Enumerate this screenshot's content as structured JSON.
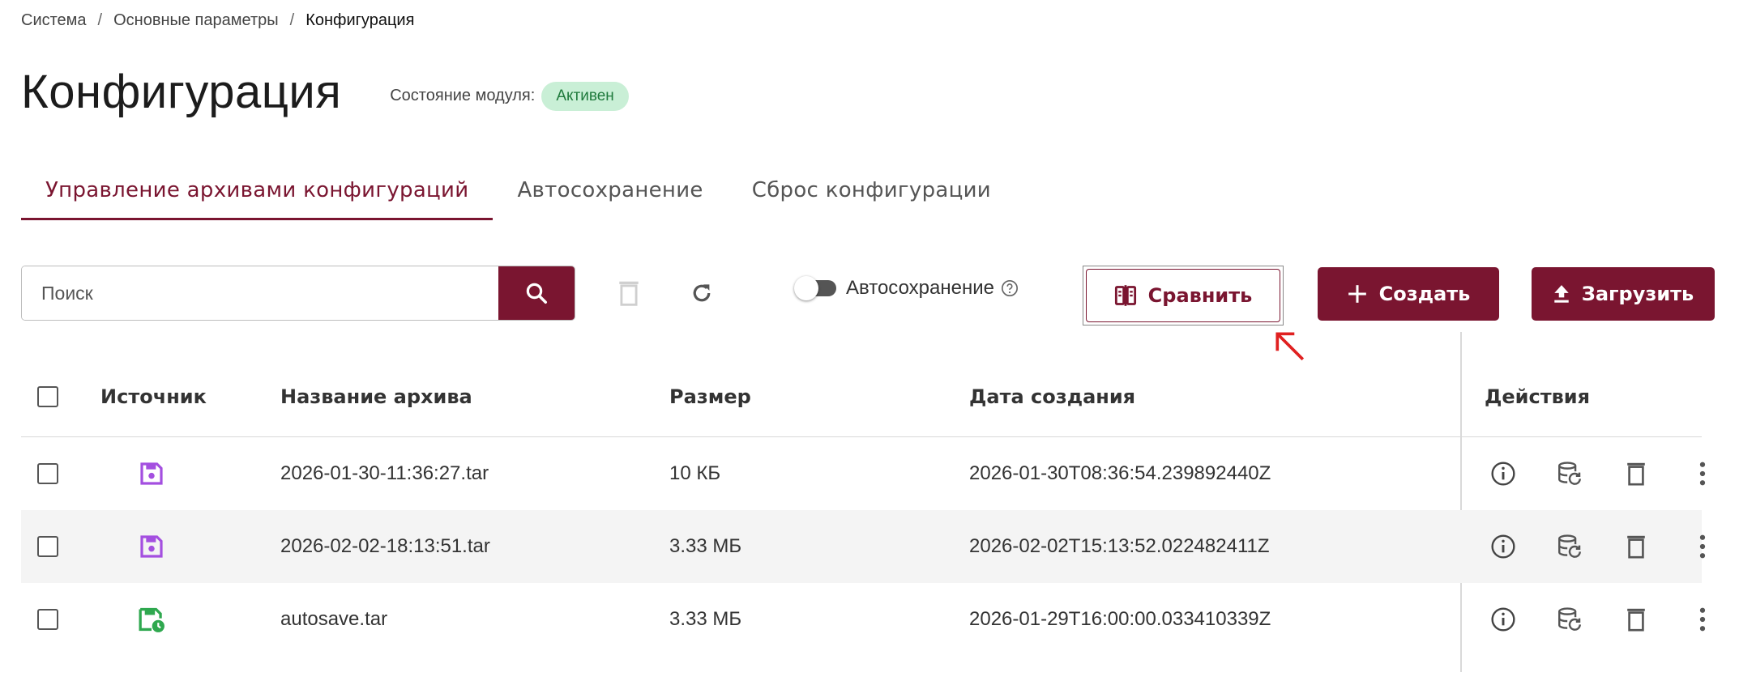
{
  "breadcrumb": [
    "Система",
    "Основные параметры",
    "Конфигурация"
  ],
  "page_title": "Конфигурация",
  "module_state": {
    "label": "Состояние модуля:",
    "status": "Активен",
    "status_color": "#c9efd6"
  },
  "tabs": [
    {
      "label": "Управление архивами конфигураций",
      "active": true
    },
    {
      "label": "Автосохранение",
      "active": false
    },
    {
      "label": "Сброс конфигурации",
      "active": false
    }
  ],
  "toolbar": {
    "search_placeholder": "Поиск",
    "autosave_label": "Автосохранение",
    "autosave_enabled": false,
    "compare_label": "Сравнить",
    "create_label": "Создать",
    "upload_label": "Загрузить"
  },
  "table": {
    "columns": [
      "Источник",
      "Название архива",
      "Размер",
      "Дата создания",
      "Действия"
    ],
    "rows": [
      {
        "source_icon": "save-icon",
        "name": "2026-01-30-11:36:27.tar",
        "size": "10 КБ",
        "date": "2026-01-30T08:36:54.239892440Z"
      },
      {
        "source_icon": "save-icon",
        "name": "2026-02-02-18:13:51.tar",
        "size": "3.33 МБ",
        "date": "2026-02-02T15:13:52.022482411Z"
      },
      {
        "source_icon": "autosave-icon",
        "name": "autosave.tar",
        "size": "3.33 МБ",
        "date": "2026-01-29T16:00:00.033410339Z"
      }
    ]
  },
  "colors": {
    "accent": "#7a1530",
    "manual_source": "#a44fe0",
    "autosave_source": "#2fa84f",
    "annotation_arrow": "#e02020"
  }
}
